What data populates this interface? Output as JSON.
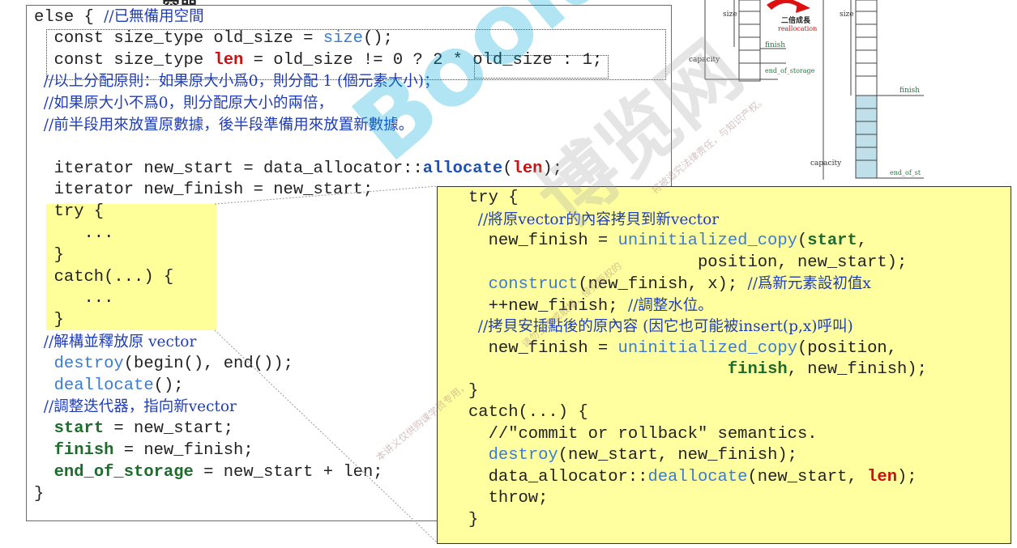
{
  "title": "容器",
  "left_code": [
    [
      {
        "t": "else { ",
        "c": "plain"
      },
      {
        "t": "//已無備用空間",
        "c": "cjk"
      }
    ],
    [
      {
        "t": "  const size_type old_size = ",
        "c": "plain"
      },
      {
        "t": "size",
        "c": "lb"
      },
      {
        "t": "();",
        "c": "plain"
      }
    ],
    [
      {
        "t": "  const size_type ",
        "c": "plain"
      },
      {
        "t": "len",
        "c": "red"
      },
      {
        "t": " = old_size != 0 ? 2 * old_size : 1;",
        "c": "plain"
      }
    ],
    [
      {
        "t": "  //以上分配原則：如果原大小爲0，則分配 1 (個元素大小)；",
        "c": "cjk"
      }
    ],
    [
      {
        "t": "  //如果原大小不爲0，則分配原大小的兩倍，",
        "c": "cjk"
      }
    ],
    [
      {
        "t": "  //前半段用來放置原數據，後半段準備用來放置新數據。",
        "c": "cjk"
      }
    ],
    [
      {
        "t": "",
        "c": "plain"
      }
    ],
    [
      {
        "t": "  iterator new_start = data_allocator::",
        "c": "plain"
      },
      {
        "t": "allocate",
        "c": "bblue"
      },
      {
        "t": "(",
        "c": "plain"
      },
      {
        "t": "len",
        "c": "red"
      },
      {
        "t": ");",
        "c": "plain"
      }
    ],
    [
      {
        "t": "  iterator new_finish = new_start;",
        "c": "plain"
      }
    ],
    [
      {
        "t": "  try {",
        "c": "plain"
      }
    ],
    [
      {
        "t": "     ...",
        "c": "plain"
      }
    ],
    [
      {
        "t": "  }",
        "c": "plain"
      }
    ],
    [
      {
        "t": "  catch(...) {",
        "c": "plain"
      }
    ],
    [
      {
        "t": "     ...",
        "c": "plain"
      }
    ],
    [
      {
        "t": "  }",
        "c": "plain"
      }
    ],
    [
      {
        "t": "  //解構並釋放原 vector",
        "c": "cjk"
      }
    ],
    [
      {
        "t": "  ",
        "c": "plain"
      },
      {
        "t": "destroy",
        "c": "lb"
      },
      {
        "t": "(begin(), end());",
        "c": "plain"
      }
    ],
    [
      {
        "t": "  ",
        "c": "plain"
      },
      {
        "t": "deallocate",
        "c": "lb"
      },
      {
        "t": "();",
        "c": "plain"
      }
    ],
    [
      {
        "t": "  //調整迭代器，指向新vector",
        "c": "cjk"
      }
    ],
    [
      {
        "t": "  ",
        "c": "plain"
      },
      {
        "t": "start",
        "c": "green"
      },
      {
        "t": " = new_start;",
        "c": "plain"
      }
    ],
    [
      {
        "t": "  ",
        "c": "plain"
      },
      {
        "t": "finish",
        "c": "green"
      },
      {
        "t": " = new_finish;",
        "c": "plain"
      }
    ],
    [
      {
        "t": "  ",
        "c": "plain"
      },
      {
        "t": "end_of_storage",
        "c": "green"
      },
      {
        "t": " = new_start + len;",
        "c": "plain"
      }
    ],
    [
      {
        "t": "}",
        "c": "plain"
      }
    ]
  ],
  "right_code": [
    [
      {
        "t": "try {",
        "c": "plain"
      }
    ],
    [
      {
        "t": "  //將原vector的內容拷貝到新vector",
        "c": "cjk"
      }
    ],
    [
      {
        "t": "  new_finish = ",
        "c": "plain"
      },
      {
        "t": "uninitialized_copy",
        "c": "lb"
      },
      {
        "t": "(",
        "c": "plain"
      },
      {
        "t": "start",
        "c": "green"
      },
      {
        "t": ",",
        "c": "plain"
      }
    ],
    [
      {
        "t": "                       position, new_start);",
        "c": "plain"
      }
    ],
    [
      {
        "t": "  ",
        "c": "plain"
      },
      {
        "t": "construct",
        "c": "lb"
      },
      {
        "t": "(new_finish, x); ",
        "c": "plain"
      },
      {
        "t": "//爲新元素設初值x",
        "c": "cjk"
      }
    ],
    [
      {
        "t": "  ++new_finish; ",
        "c": "plain"
      },
      {
        "t": "//調整水位。",
        "c": "cjk"
      }
    ],
    [
      {
        "t": "  //拷貝安插點後的原內容 (因它也可能被insert(p,x)呼叫)",
        "c": "cjk"
      }
    ],
    [
      {
        "t": "  new_finish = ",
        "c": "plain"
      },
      {
        "t": "uninitialized_copy",
        "c": "lb"
      },
      {
        "t": "(position,",
        "c": "plain"
      }
    ],
    [
      {
        "t": "                          ",
        "c": "plain"
      },
      {
        "t": "finish",
        "c": "green"
      },
      {
        "t": ", new_finish);",
        "c": "plain"
      }
    ],
    [
      {
        "t": "}",
        "c": "plain"
      }
    ],
    [
      {
        "t": "catch(...) {",
        "c": "plain"
      }
    ],
    [
      {
        "t": "  //\"commit or rollback\" semantics.",
        "c": "plain"
      }
    ],
    [
      {
        "t": "  ",
        "c": "plain"
      },
      {
        "t": "destroy",
        "c": "lb"
      },
      {
        "t": "(new_start, new_finish);",
        "c": "plain"
      }
    ],
    [
      {
        "t": "  data_allocator::",
        "c": "plain"
      },
      {
        "t": "deallocate",
        "c": "lb"
      },
      {
        "t": "(new_start, ",
        "c": "plain"
      },
      {
        "t": "len",
        "c": "red"
      },
      {
        "t": ");",
        "c": "plain"
      }
    ],
    [
      {
        "t": "  throw;",
        "c": "plain"
      }
    ],
    [
      {
        "t": "}",
        "c": "plain"
      }
    ]
  ],
  "diagram": {
    "left_labels": {
      "size": "size",
      "capacity": "capacity",
      "finish": "finish",
      "end_of_storage": "end_of_storage"
    },
    "arrow_text_1": "二倍成長",
    "arrow_text_2": "reallocation",
    "right_labels": {
      "size": "size",
      "capacity": "capacity",
      "finish": "finish",
      "end_of_storage": "end_of_st"
    }
  },
  "watermark": {
    "brand": "Boolan",
    "cn": "博览网",
    "small1": "本讲义仅供购课学员专用，",
    "small2": "请勿上传或散播，侵犯版权的",
    "small3": "将被追究法律责任，与知识产权。"
  },
  "colors": {
    "yellow_panel": "#ffffa0",
    "highlight": "#ffff99",
    "keyword_blue": "#1f3db8",
    "member_green": "#1f6b2e",
    "len_red": "#cc1010"
  }
}
